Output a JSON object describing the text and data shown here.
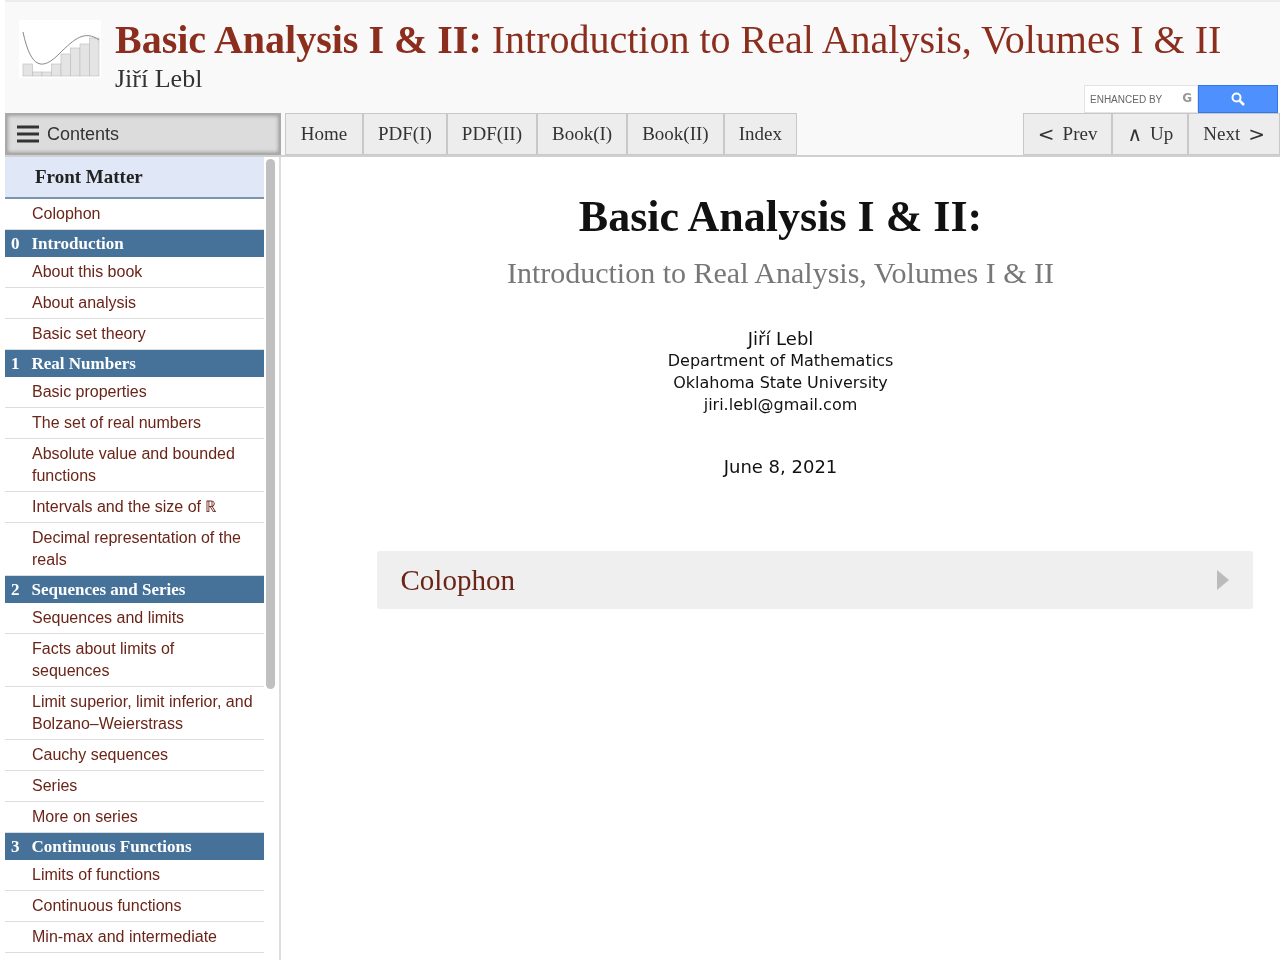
{
  "header": {
    "title": "**Basic Analysis I & II:** Introduction to Real Analysis, Volumes I & II",
    "author": "Jiří Lebl",
    "search": {
      "placeholder": "ENHANCED BY",
      "brand": "G"
    }
  },
  "toolbar": {
    "contents": "Contents",
    "links": [
      "Home",
      "PDF(I)",
      "PDF(II)",
      "Book(I)",
      "Book(II)",
      "Index"
    ],
    "nav": [
      {
        "glyph": "<",
        "label": "Prev"
      },
      {
        "glyph": "∧",
        "label": "Up"
      },
      {
        "label": "Next",
        "glyph_after": ">"
      }
    ]
  },
  "sidebar": {
    "items": [
      {
        "kind": "part",
        "label": "Front Matter"
      },
      {
        "kind": "section",
        "label": "Colophon"
      },
      {
        "kind": "chapter",
        "number": "0",
        "label": "Introduction"
      },
      {
        "kind": "section",
        "label": "About this book"
      },
      {
        "kind": "section",
        "label": "About analysis"
      },
      {
        "kind": "section",
        "label": "Basic set theory"
      },
      {
        "kind": "chapter",
        "number": "1",
        "label": "Real Numbers"
      },
      {
        "kind": "section",
        "label": "Basic properties"
      },
      {
        "kind": "section",
        "label": "The set of real numbers"
      },
      {
        "kind": "section",
        "label": "Absolute value and bounded functions"
      },
      {
        "kind": "section",
        "label": "Intervals and the size of ℝ"
      },
      {
        "kind": "section",
        "label": "Decimal representation of the reals"
      },
      {
        "kind": "chapter",
        "number": "2",
        "label": "Sequences and Series"
      },
      {
        "kind": "section",
        "label": "Sequences and limits"
      },
      {
        "kind": "section",
        "label": "Facts about limits of sequences"
      },
      {
        "kind": "section",
        "label": "Limit superior, limit inferior, and Bolzano–Weierstrass"
      },
      {
        "kind": "section",
        "label": "Cauchy sequences"
      },
      {
        "kind": "section",
        "label": "Series"
      },
      {
        "kind": "section",
        "label": "More on series"
      },
      {
        "kind": "chapter",
        "number": "3",
        "label": "Continuous Functions"
      },
      {
        "kind": "section",
        "label": "Limits of functions"
      },
      {
        "kind": "section",
        "label": "Continuous functions"
      },
      {
        "kind": "section",
        "label": "Min-max and intermediate"
      }
    ]
  },
  "main": {
    "title": "Basic Analysis I & II:",
    "subtitle": "Introduction to Real Analysis, Volumes I & II",
    "author_lines": [
      "Jiří Lebl",
      "Department of Mathematics",
      "Oklahoma State University",
      "jiri.lebl@gmail.com"
    ],
    "date": "June 8, 2021",
    "sections": [
      {
        "label": "Colophon",
        "expanded": false
      }
    ]
  }
}
